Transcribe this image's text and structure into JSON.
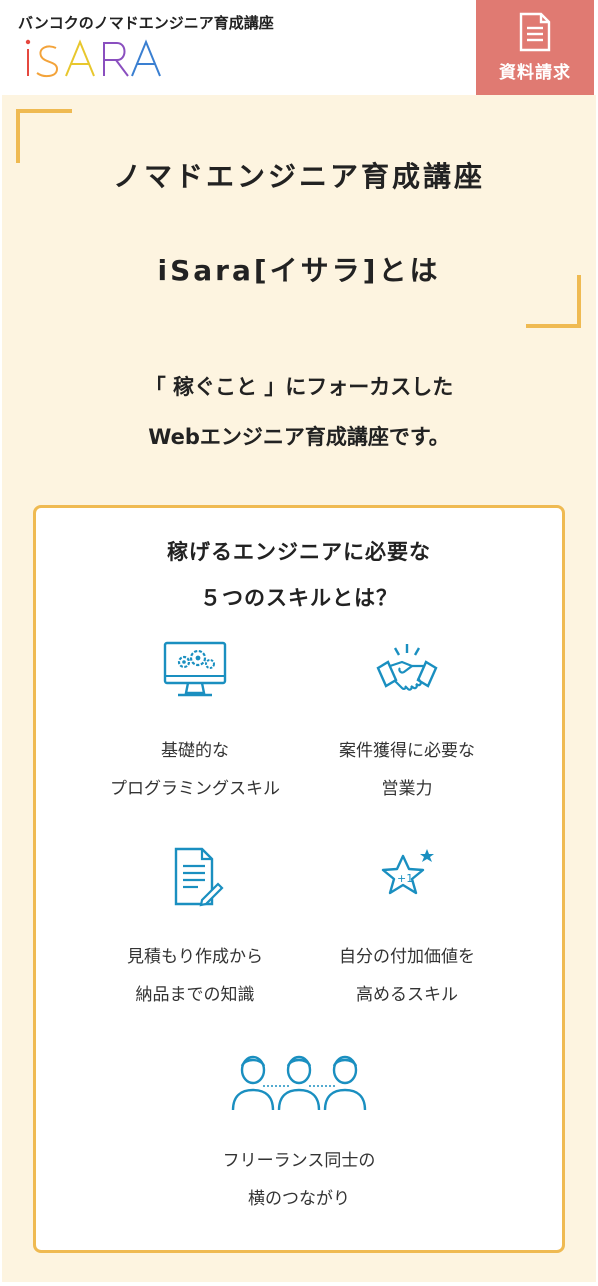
{
  "header": {
    "tagline": "バンコクのノマドエンジニア育成講座",
    "logo_text": "iSARA",
    "cta_label": "資料請求",
    "cta_icon": "document-icon",
    "cta_color": "#e07a72"
  },
  "hero": {
    "heading_line1": "ノマドエンジニア育成講座",
    "heading_line2": "iSara[イサラ]とは",
    "accent_color": "#efba52",
    "background_color": "#fdf4e0"
  },
  "lead": {
    "line1": "「 稼ぐこと 」にフォーカスした",
    "line2": "Webエンジニア育成講座です。"
  },
  "skills_card": {
    "title_line1": "稼げるエンジニアに必要な",
    "title_line2": "５つのスキルとは？",
    "icon_color": "#1a8fc0",
    "items": [
      {
        "icon": "computer-gears-icon",
        "line1": "基礎的な",
        "line2": "プログラミングスキル"
      },
      {
        "icon": "handshake-icon",
        "line1": "案件獲得に必要な",
        "line2": "営業力"
      },
      {
        "icon": "document-pen-icon",
        "line1": "見積もり作成から",
        "line2": "納品までの知識"
      },
      {
        "icon": "star-plus-one-icon",
        "line1": "自分の付加価値を",
        "line2": "高めるスキル"
      },
      {
        "icon": "people-network-icon",
        "line1": "フリーランス同士の",
        "line2": "横のつながり"
      }
    ]
  }
}
